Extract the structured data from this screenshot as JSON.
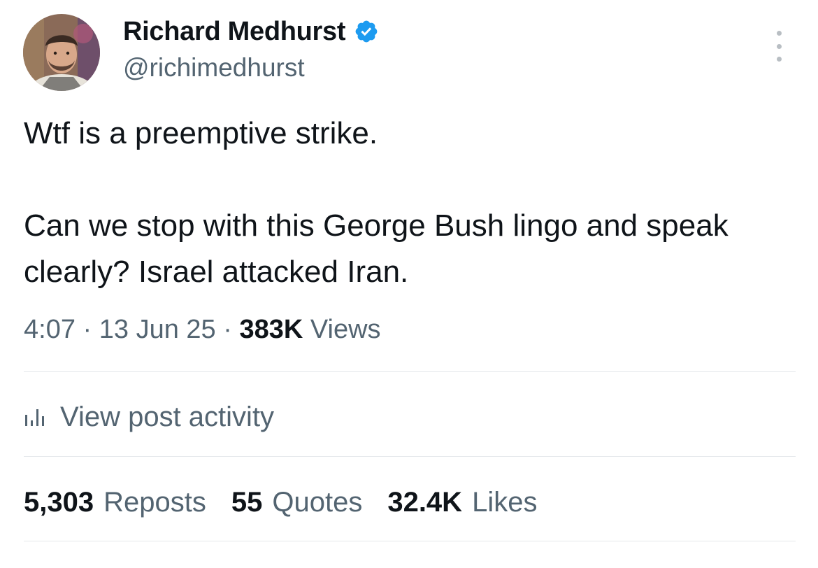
{
  "author": {
    "display_name": "Richard Medhurst",
    "handle": "@richimedhurst",
    "verified": true,
    "verified_badge_color": "#1d9bf0"
  },
  "tweet": {
    "paragraphs": [
      "Wtf is a preemptive strike.",
      "Can we stop with this George Bush lingo and speak clearly? Israel attacked Iran."
    ]
  },
  "meta": {
    "time": "4:07",
    "separator": "·",
    "date": "13 Jun 25",
    "views_count": "383K",
    "views_label": "Views"
  },
  "activity": {
    "label": "View post activity",
    "icon": "bar-chart-icon"
  },
  "stats": [
    {
      "count": "5,303",
      "label": "Reposts"
    },
    {
      "count": "55",
      "label": "Quotes"
    },
    {
      "count": "32.4K",
      "label": "Likes"
    }
  ],
  "colors": {
    "text_primary": "#0f1419",
    "text_secondary": "#536471",
    "divider": "#e4e8eb"
  }
}
